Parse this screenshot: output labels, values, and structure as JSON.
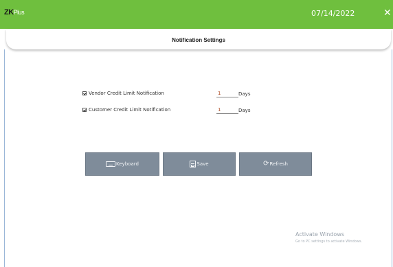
{
  "app": {
    "logo_zk": "ZK",
    "logo_plus": "Plus",
    "date": "07/14/2022",
    "close_glyph": "✕"
  },
  "header": {
    "title": "Notification Settings"
  },
  "settings": {
    "vendor": {
      "label": "Vendor Credit Limit Notification",
      "checked": true,
      "value": "1",
      "unit": "Days"
    },
    "customer": {
      "label": "Customer Credit Limit Notification",
      "checked": true,
      "value": "1",
      "unit": "Days"
    }
  },
  "buttons": {
    "keyboard": "Keyboard",
    "save": "Save",
    "refresh": "Refresh",
    "refresh_icon": "refresh-icon",
    "save_icon": "floppy-disk-icon",
    "keyboard_icon": "keyboard-icon"
  },
  "watermark": {
    "title": "Activate Windows",
    "subtitle": "Go to PC settings to activate Windows."
  },
  "colors": {
    "titlebar": "#6fbf3e",
    "button": "#7f8c9a",
    "input_text": "#b0502a"
  }
}
